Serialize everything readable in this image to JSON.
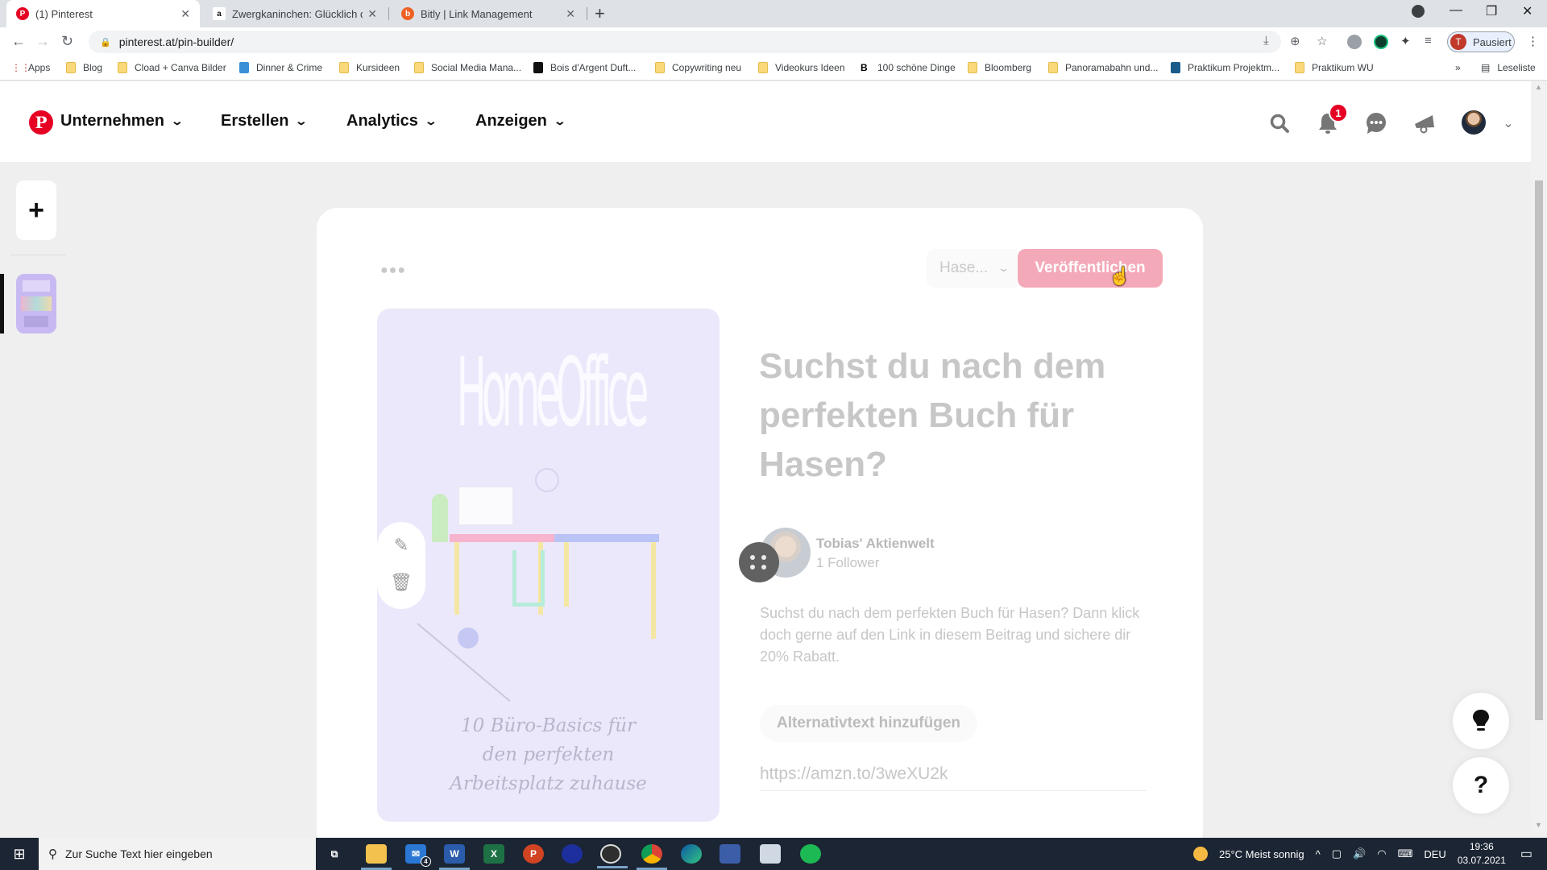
{
  "browser": {
    "tabs": [
      {
        "title": "(1) Pinterest",
        "icon": "pinterest-icon",
        "active": true
      },
      {
        "title": "Zwergkaninchen: Glücklich durch",
        "icon": "amazon-icon",
        "active": false
      },
      {
        "title": "Bitly | Link Management",
        "icon": "bitly-icon",
        "active": false
      }
    ],
    "new_tab": "+",
    "url": "pinterest.at/pin-builder/",
    "profile_initial": "T",
    "profile_status": "Pausiert",
    "bookmarks": [
      {
        "label": "Apps",
        "icon": "apps-grid-icon"
      },
      {
        "label": "Blog",
        "icon": "folder-icon"
      },
      {
        "label": "Cload + Canva Bilder",
        "icon": "folder-icon"
      },
      {
        "label": "Dinner & Crime",
        "icon": "jd-icon"
      },
      {
        "label": "Kursideen",
        "icon": "folder-icon"
      },
      {
        "label": "Social Media Mana...",
        "icon": "folder-icon"
      },
      {
        "label": "Bois d'Argent Duft...",
        "icon": "bois-icon"
      },
      {
        "label": "Copywriting neu",
        "icon": "folder-icon"
      },
      {
        "label": "Videokurs Ideen",
        "icon": "folder-icon"
      },
      {
        "label": "100 schöne Dinge",
        "icon": "b-icon"
      },
      {
        "label": "Bloomberg",
        "icon": "folder-icon"
      },
      {
        "label": "Panoramabahn und...",
        "icon": "folder-icon"
      },
      {
        "label": "Praktikum Projektm...",
        "icon": "j-icon"
      },
      {
        "label": "Praktikum WU",
        "icon": "folder-icon"
      }
    ],
    "bookmarks_overflow": "»",
    "reading_list": "Leseliste"
  },
  "pinterest": {
    "nav": [
      {
        "label": "Unternehmen"
      },
      {
        "label": "Erstellen"
      },
      {
        "label": "Analytics"
      },
      {
        "label": "Anzeigen"
      }
    ],
    "notification_count": "1",
    "brand_color": "#e60023"
  },
  "pin_builder": {
    "board_select": "Hase...",
    "publish_label": "Veröffentlichen",
    "image": {
      "headline": "HomeOffice",
      "caption_lines": [
        "10 Büro-Basics für",
        "den perfekten",
        "Arbeitsplatz zuhause"
      ]
    },
    "title": "Suchst du nach dem perfekten Buch für Hasen?",
    "creator": {
      "name": "Tobias' Aktienwelt",
      "followers": "1 Follower"
    },
    "description": "Suchst du nach dem perfekten Buch für Hasen? Dann klick doch gerne auf den Link in diesem Beitrag und sichere dir 20% Rabatt.",
    "alt_text_label": "Alternativtext hinzufügen",
    "link": "https://amzn.to/3weXU2k"
  },
  "fabs": {
    "tip": "lightbulb",
    "help": "?"
  },
  "taskbar": {
    "search_placeholder": "Zur Suche Text hier eingeben",
    "mail_badge": "4",
    "weather": "25°C  Meist sonnig",
    "language": "DEU",
    "time": "19:36",
    "date": "03.07.2021"
  }
}
